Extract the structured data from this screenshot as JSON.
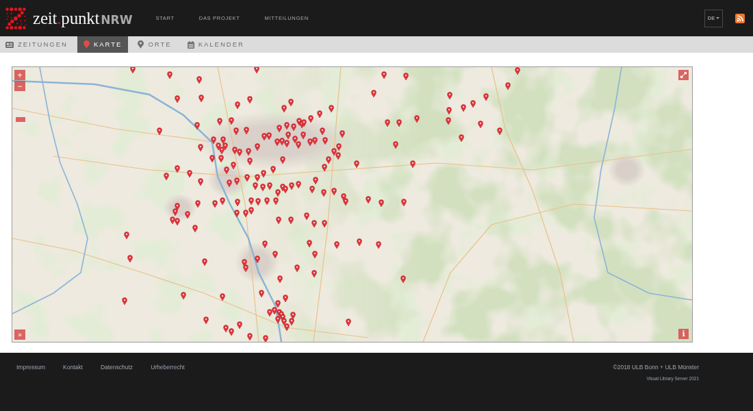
{
  "header": {
    "logo": {
      "prefix": "zeit",
      "dot": ".",
      "main": "punkt",
      "suffix": "NRW"
    },
    "nav": [
      {
        "label": "START"
      },
      {
        "label": "DAS PROJEKT"
      },
      {
        "label": "MITTEILUNGEN"
      }
    ],
    "language": {
      "value": "DE"
    }
  },
  "tabs": [
    {
      "label": "ZEITUNGEN",
      "kind": "newspapers",
      "selected": false
    },
    {
      "label": "KARTE",
      "kind": "map",
      "selected": true
    },
    {
      "label": "ORTE",
      "kind": "places",
      "selected": false
    },
    {
      "label": "KALENDER",
      "kind": "calendar",
      "selected": false
    }
  ],
  "map": {
    "zoom_in": "+",
    "zoom_out": "−",
    "sidebar_toggle": "»",
    "info": "i"
  },
  "footer": {
    "links": [
      {
        "label": "Impressum"
      },
      {
        "label": "Kontakt"
      },
      {
        "label": "Datenschutz"
      },
      {
        "label": "Urheberrecht"
      }
    ],
    "copyright": "©2018 ULB Bonn + ULB Münster",
    "version": "Visual Library Server 2021"
  }
}
